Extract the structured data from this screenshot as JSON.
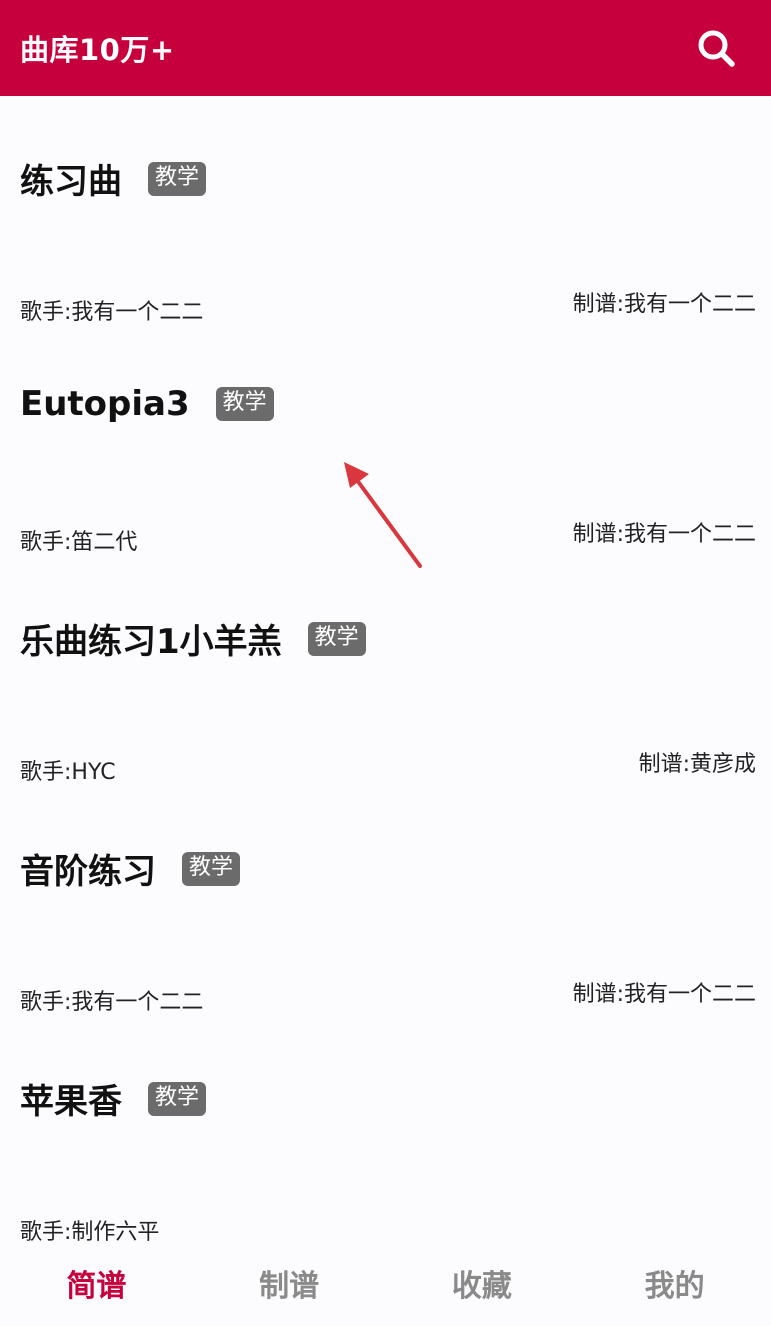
{
  "header": {
    "title": "曲库10万+",
    "search_icon": "search-icon"
  },
  "songs": [
    {
      "title": "练习曲",
      "tag": "教学",
      "singer": "歌手:我有一个二二",
      "arranger": "制谱:我有一个二二"
    },
    {
      "title": "Eutopia3",
      "tag": "教学",
      "singer": "歌手:笛二代",
      "arranger": "制谱:我有一个二二"
    },
    {
      "title": "乐曲练习1小羊羔",
      "tag": "教学",
      "singer": "歌手:HYC",
      "arranger": "制谱:黄彦成"
    },
    {
      "title": "音阶练习",
      "tag": "教学",
      "singer": "歌手:我有一个二二",
      "arranger": "制谱:我有一个二二"
    },
    {
      "title": "苹果香",
      "tag": "教学",
      "singer": "歌手:制作六平",
      "arranger": ""
    }
  ],
  "bottom_nav": {
    "tabs": [
      {
        "label": "简谱",
        "active": true
      },
      {
        "label": "制谱",
        "active": false
      },
      {
        "label": "收藏",
        "active": false
      },
      {
        "label": "我的",
        "active": false
      }
    ]
  },
  "colors": {
    "brand": "#c6003d",
    "tag_bg": "#6b6b6b",
    "inactive_tab": "#8a8a8a",
    "annotation_arrow": "#d9363e"
  }
}
